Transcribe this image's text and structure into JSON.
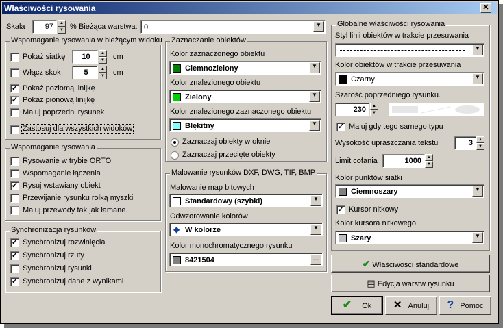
{
  "window": {
    "title": "Właściwości rysowania",
    "close_glyph": "✕"
  },
  "top": {
    "scale_label": "Skala",
    "scale_value": "97",
    "scale_unit": "%",
    "layer_label": "Bieżąca warstwa:",
    "layer_value": "0"
  },
  "group_view": {
    "title": "Wspomaganie rysowania w bieżącym widoku",
    "grid_label": "Pokaż siatkę",
    "grid_checked": false,
    "grid_value": "10",
    "grid_unit": "cm",
    "step_label": "Włącz skok",
    "step_checked": false,
    "step_value": "5",
    "step_unit": "cm",
    "hruler_label": "Pokaż poziomą linijkę",
    "hruler_checked": true,
    "vruler_label": "Pokaż pionową linijkę",
    "vruler_checked": true,
    "prev_label": "Maluj poprzedni rysunek",
    "prev_checked": false,
    "all_label": "Zastosuj dla wszystkich widoków",
    "all_checked": false
  },
  "group_draw": {
    "title": "Wspomaganie rysowania",
    "items": [
      {
        "label": "Rysowanie w trybie ORTO",
        "checked": false
      },
      {
        "label": "Wspomaganie łączenia",
        "checked": false
      },
      {
        "label": "Rysuj wstawiany obiekt",
        "checked": true
      },
      {
        "label": "Przewijanie rysunku rolką myszki",
        "checked": false
      },
      {
        "label": "Maluj przewody tak jak łamane.",
        "checked": false
      }
    ]
  },
  "group_sync": {
    "title": "Synchronizacja rysunków",
    "items": [
      {
        "label": "Synchronizuj rozwinięcia",
        "checked": true
      },
      {
        "label": "Synchronizuj rzuty",
        "checked": true
      },
      {
        "label": "Synchronizuj rysunki",
        "checked": false
      },
      {
        "label": "Synchronizuj dane z wynikami",
        "checked": true
      }
    ]
  },
  "group_select": {
    "title": "Zaznaczanie obiektów",
    "selected_label": "Kolor zaznaczonego obiektu",
    "selected_value": "Ciemnozielony",
    "selected_color": "#008000",
    "found_label": "Kolor znalezionego obiektu",
    "found_value": "Zielony",
    "found_color": "#00d000",
    "found_sel_label": "Kolor znalezionego zaznaczonego obiektu",
    "found_sel_value": "Błękitny",
    "found_sel_color": "#80ffff",
    "radio_window": "Zaznaczaj obiekty w oknie",
    "radio_window_on": true,
    "radio_cross": "Zaznaczaj przecięte obiekty",
    "radio_cross_on": false
  },
  "group_paint": {
    "title": "Malowanie rysunków DXF, DWG, TIF, BMP",
    "bitmap_label": "Malowanie map bitowych",
    "bitmap_value": "Standardowy (szybki)",
    "bitmap_color": "#ffffff",
    "color_label": "Odwzorowanie kolorów",
    "color_value": "W kolorze",
    "mono_label": "Kolor monochromatycznego rysunku",
    "mono_value": "8421504",
    "mono_color": "#808080",
    "mono_btn": "..."
  },
  "group_global": {
    "title": "Globalne właściwości rysowania",
    "line_style_label": "Styl linii obiektów w trakcie przesuwania",
    "move_color_label": "Kolor obiektów w trakcie przesuwania",
    "move_color_value": "Czarny",
    "move_color": "#000000",
    "gray_label": "Szarość poprzedniego rysunku.",
    "gray_value": "230",
    "same_type_label": "Maluj gdy tego samego typu",
    "same_type_checked": true,
    "text_simplify_label": "Wysokość upraszczania tekstu",
    "text_simplify_value": "3",
    "undo_label": "Limit cofania",
    "undo_value": "1000",
    "grid_points_label": "Kolor punktów siatki",
    "grid_points_value": "Ciemnoszary",
    "grid_points_color": "#808080",
    "cursor_label": "Kursor nitkowy",
    "cursor_checked": true,
    "cursor_color_label": "Kolor kursora nitkowego",
    "cursor_color_value": "Szary",
    "cursor_color": "#c0c0c0"
  },
  "buttons": {
    "standard": "Właściwości standardowe",
    "layers": "Edycja warstw rysunku",
    "ok": "Ok",
    "cancel": "Anuluj",
    "help": "Pomoc"
  },
  "colors": {
    "title_bar_start": "#0a246a",
    "title_bar_end": "#a6caf0",
    "face": "#d4d0c8",
    "ok_icon": "#1a8a1a",
    "cancel_icon": "#000000",
    "help_icon": "#1040a0"
  }
}
